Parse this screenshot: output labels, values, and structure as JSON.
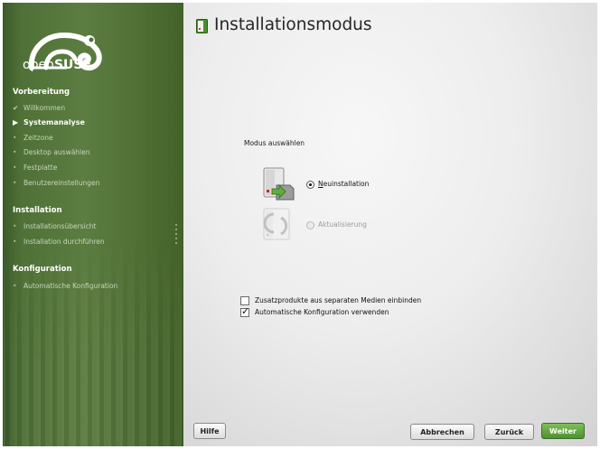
{
  "logo": {
    "open": "open",
    "suse": "SUSE",
    "icon": "chameleon-icon"
  },
  "sidebar": {
    "sections": [
      {
        "title": "Vorbereitung"
      },
      {
        "title": "Installation"
      },
      {
        "title": "Konfiguration"
      }
    ],
    "steps": [
      {
        "label": "Willkommen",
        "status": "done"
      },
      {
        "label": "Systemanalyse",
        "status": "current"
      },
      {
        "label": "Zeitzone",
        "status": "pending"
      },
      {
        "label": "Desktop auswählen",
        "status": "pending"
      },
      {
        "label": "Festplatte",
        "status": "pending"
      },
      {
        "label": "Benutzereinstellungen",
        "status": "pending"
      },
      {
        "label": "Installationsübersicht",
        "status": "pending"
      },
      {
        "label": "Installation durchführen",
        "status": "pending"
      },
      {
        "label": "Automatische Konfiguration",
        "status": "pending"
      }
    ]
  },
  "main": {
    "title": "Installationsmodus",
    "mode_label": "Modus auswählen",
    "options": [
      {
        "label": "Neuinstallation",
        "selected": true,
        "enabled": true,
        "icon": "new-install-icon"
      },
      {
        "label": "Aktualisierung",
        "selected": false,
        "enabled": false,
        "icon": "update-icon"
      }
    ],
    "checkboxes": [
      {
        "label": "Zusatzprodukte aus separaten Medien einbinden",
        "checked": false
      },
      {
        "label": "Automatische Konfiguration verwenden",
        "checked": true
      }
    ]
  },
  "buttons": {
    "help": "Hilfe",
    "abort": "Abbrechen",
    "back": "Zurück",
    "next": "Weiter"
  },
  "colors": {
    "sidebar_green": "#5c7d41",
    "primary_button": "#4e8f31"
  }
}
